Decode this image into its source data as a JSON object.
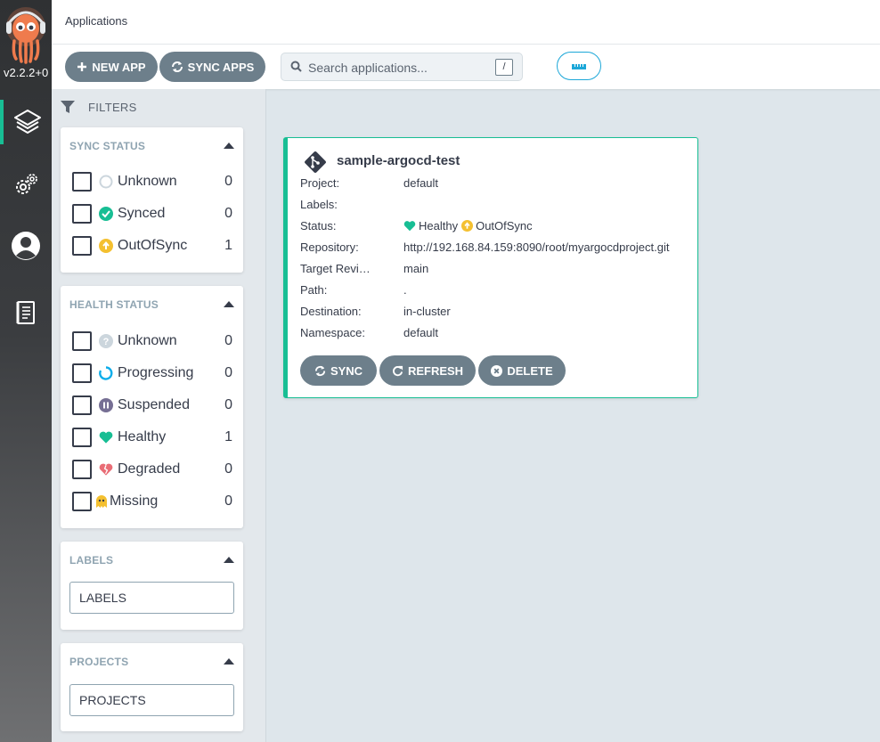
{
  "nav": {
    "version": "v2.2.2+0",
    "items": [
      {
        "name": "applications",
        "icon": "layers-icon"
      },
      {
        "name": "settings",
        "icon": "gears-icon"
      },
      {
        "name": "user-info",
        "icon": "user-circle-icon"
      },
      {
        "name": "docs",
        "icon": "book-icon"
      }
    ]
  },
  "header": {
    "title": "Applications"
  },
  "toolbar": {
    "new_app_label": "NEW APP",
    "sync_apps_label": "SYNC APPS",
    "search_placeholder": "Search applications...",
    "search_shortcut": "/",
    "view_icon": "ruler-icon"
  },
  "filters": {
    "title": "FILTERS",
    "sync_status": {
      "title": "SYNC STATUS",
      "items": [
        {
          "label": "Unknown",
          "count": "0",
          "icon": "circle-outline-icon",
          "color": "#ccd6dd"
        },
        {
          "label": "Synced",
          "count": "0",
          "icon": "check-circle-icon",
          "color": "#18be94"
        },
        {
          "label": "OutOfSync",
          "count": "1",
          "icon": "arrow-up-circle-icon",
          "color": "#f4c030"
        }
      ]
    },
    "health_status": {
      "title": "HEALTH STATUS",
      "items": [
        {
          "label": "Unknown",
          "count": "0",
          "icon": "question-circle-icon",
          "color": "#ccd6dd"
        },
        {
          "label": "Progressing",
          "count": "0",
          "icon": "spinner-icon",
          "color": "#0dadea"
        },
        {
          "label": "Suspended",
          "count": "0",
          "icon": "pause-circle-icon",
          "color": "#766f94"
        },
        {
          "label": "Healthy",
          "count": "1",
          "icon": "heart-icon",
          "color": "#18be94"
        },
        {
          "label": "Degraded",
          "count": "0",
          "icon": "heart-broken-icon",
          "color": "#e96d76"
        },
        {
          "label": "Missing",
          "count": "0",
          "icon": "ghost-icon",
          "color": "#f4c030"
        }
      ]
    },
    "labels": {
      "title": "LABELS",
      "placeholder": "LABELS"
    },
    "projects": {
      "title": "PROJECTS",
      "placeholder": "PROJECTS"
    }
  },
  "app_card": {
    "name": "sample-argocd-test",
    "rows": [
      {
        "key": "Project:",
        "value": "default"
      },
      {
        "key": "Labels:",
        "value": ""
      },
      {
        "key": "Status:",
        "value": ""
      },
      {
        "key": "Repository:",
        "value": "http://192.168.84.159:8090/root/myargocdproject.git"
      },
      {
        "key": "Target Revision:",
        "value": "main"
      },
      {
        "key": "Path:",
        "value": "."
      },
      {
        "key": "Destination:",
        "value": "in-cluster"
      },
      {
        "key": "Namespace:",
        "value": "default"
      }
    ],
    "health": "Healthy",
    "sync": "OutOfSync",
    "actions": {
      "sync": "SYNC",
      "refresh": "REFRESH",
      "delete": "DELETE"
    }
  },
  "colors": {
    "accent": "#18be94",
    "button": "#6d7f8b",
    "link": "#1ca7d8"
  }
}
